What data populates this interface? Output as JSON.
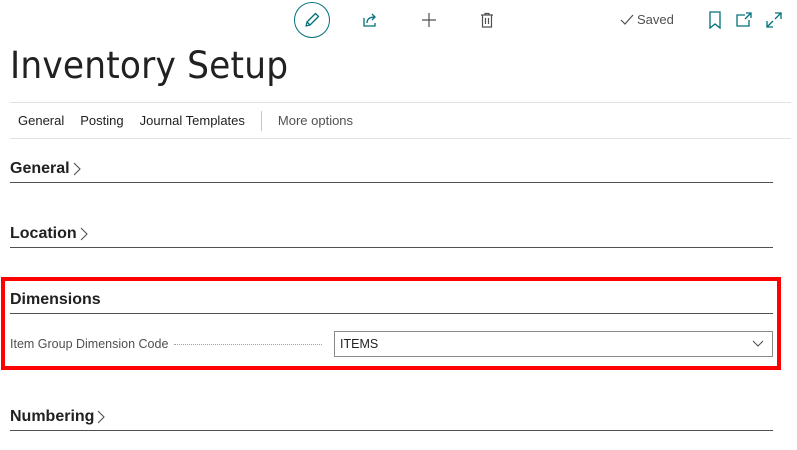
{
  "toolbar": {
    "edit_icon": "pencil-icon",
    "share_icon": "share-icon",
    "new_icon": "plus-icon",
    "delete_icon": "trash-icon",
    "saved_label": "Saved",
    "bookmark_icon": "bookmark-icon",
    "popout_icon": "open-new-window-icon",
    "expand_icon": "expand-icon"
  },
  "page": {
    "title": "Inventory Setup"
  },
  "tabs": {
    "general": "General",
    "posting": "Posting",
    "journal_templates": "Journal Templates",
    "more_options": "More options"
  },
  "sections": {
    "general": "General",
    "location": "Location",
    "dimensions": "Dimensions",
    "numbering": "Numbering"
  },
  "dimensions": {
    "item_group_label": "Item Group Dimension Code",
    "item_group_value": "ITEMS"
  },
  "colors": {
    "accent": "#00707a",
    "highlight": "#ff0000"
  }
}
